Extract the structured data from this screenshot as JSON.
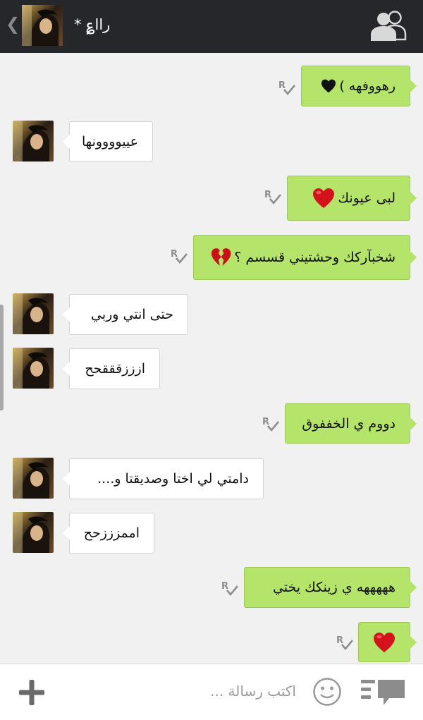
{
  "header": {
    "back_glyph": "❮",
    "title": "راا؏ *",
    "avatar_icon": "contact-avatar",
    "contacts_icon": "contacts-icon"
  },
  "messages": [
    {
      "dir": "out",
      "text": "رهووفهه )",
      "emoji": "black-heart"
    },
    {
      "dir": "in",
      "text": "عييوووونها"
    },
    {
      "dir": "out",
      "text": "لبى عيونك",
      "emoji": "red-heart"
    },
    {
      "dir": "out",
      "text": "شخبآركك وحشتيني قسسم ؟",
      "emoji": "broken-heart"
    },
    {
      "dir": "in",
      "text": "حتى انتي وربي"
    },
    {
      "dir": "in",
      "text": "ازززقققحح"
    },
    {
      "dir": "out",
      "text": "دووم ي الخففوق"
    },
    {
      "dir": "in",
      "text": "دامتي لي اختا وصديقتا و...."
    },
    {
      "dir": "in",
      "text": "اممزززحح"
    },
    {
      "dir": "out",
      "text": "هههههه ي زينكك يختي"
    },
    {
      "dir": "out",
      "text": "",
      "emoji": "red-heart"
    }
  ],
  "input": {
    "placeholder": "اكتب رسالة ...",
    "plus_icon": "plus-icon",
    "emoji_icon": "smiley-icon",
    "menu_icon": "chat-menu-icon"
  },
  "colors": {
    "header_bg": "#26272b",
    "outgoing_bubble": "#b5e46a",
    "incoming_bubble": "#ffffff",
    "chat_bg": "#f1f1f1"
  }
}
